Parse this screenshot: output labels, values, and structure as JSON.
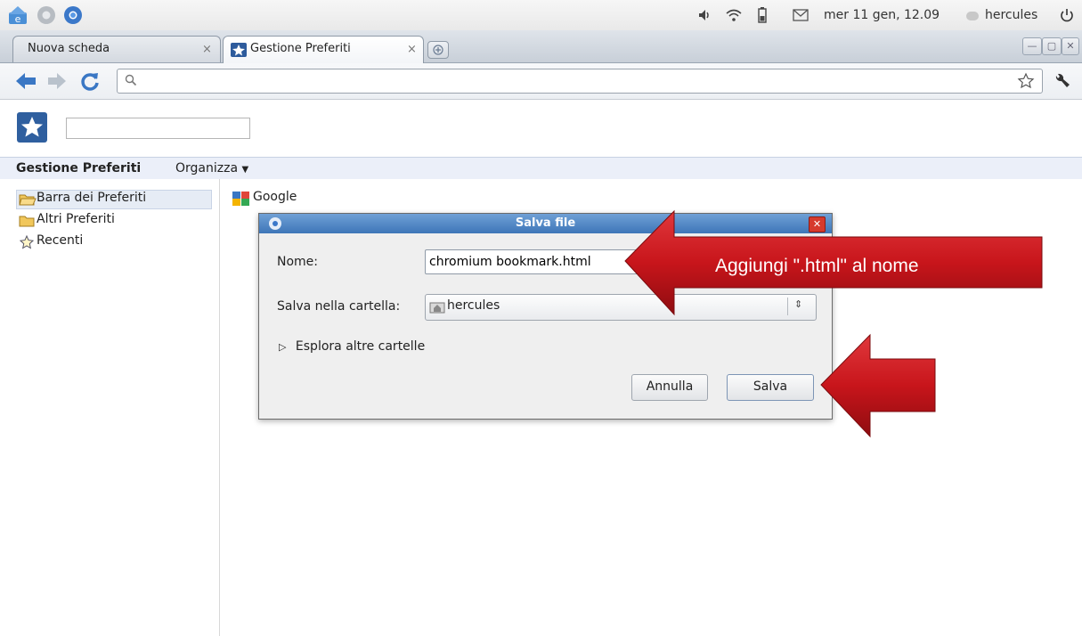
{
  "system_panel": {
    "datetime": "mer 11 gen, 12.09",
    "user": "hercules"
  },
  "tabs": [
    {
      "title": "Nuova scheda",
      "active": false
    },
    {
      "title": "Gestione Preferiti",
      "active": true
    }
  ],
  "toolbar": {
    "url_value": ""
  },
  "bookmarks_page": {
    "title": "Gestione Preferiti",
    "organize_menu": "Organizza",
    "tree": [
      {
        "label": "Barra dei Preferiti",
        "icon": "folder-open-icon",
        "selected": true
      },
      {
        "label": "Altri Preferiti",
        "icon": "folder-icon",
        "selected": false
      },
      {
        "label": "Recenti",
        "icon": "star-outline-icon",
        "selected": false
      }
    ],
    "list": [
      {
        "label": "Google",
        "icon": "google-icon"
      }
    ]
  },
  "save_dialog": {
    "title": "Salva file",
    "name_label": "Nome:",
    "name_value": "chromium bookmark.html",
    "folder_label": "Salva nella cartella:",
    "folder_value": "hercules",
    "browse_label": "Esplora altre cartelle",
    "cancel_label": "Annulla",
    "save_label": "Salva"
  },
  "annotation": {
    "callout_text": "Aggiungi \".html\" al nome",
    "arrow_color": "#c8151b"
  }
}
